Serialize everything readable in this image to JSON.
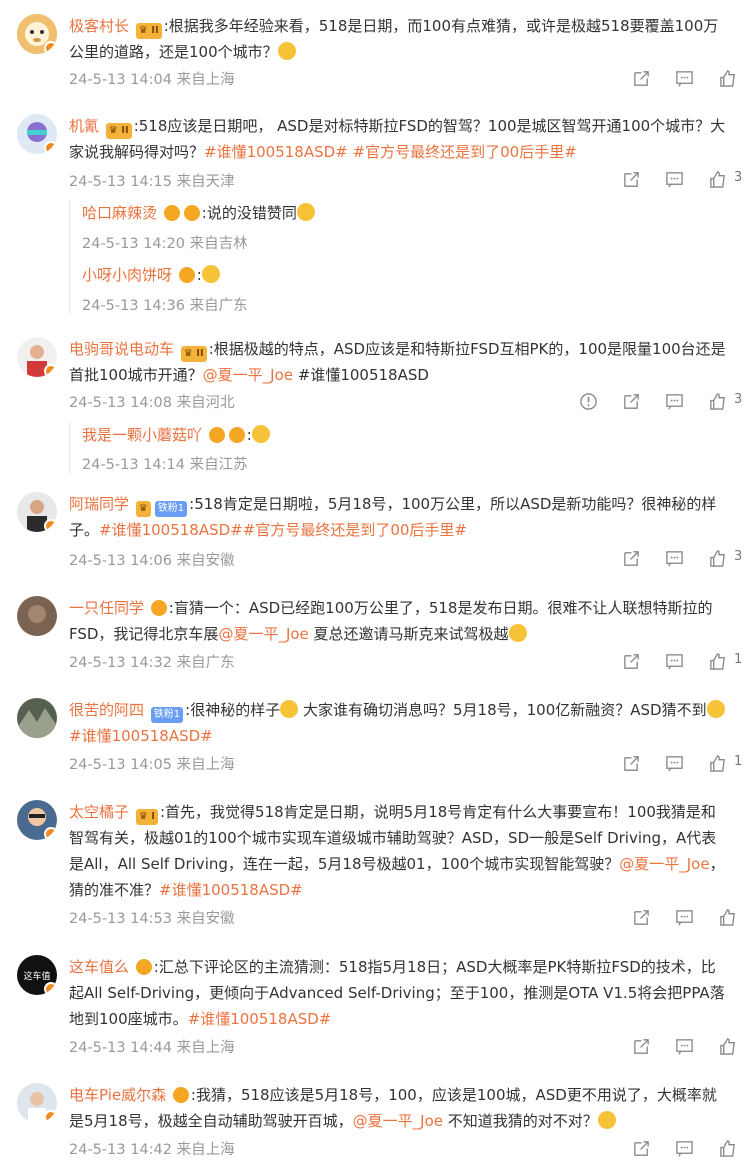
{
  "comments": [
    {
      "user": "极客村长",
      "text": ":根据我多年经验来看，518是日期，而100有点难猜，或许是极越518要覆盖100万公里的道路，还是100个城市？",
      "meta": "24-5-13 14:04 来自上海",
      "likes": ""
    },
    {
      "user": "机氰",
      "text_a": ":518应该是日期吧， ASD是对标特斯拉FSD的智驾？100是城区智驾开通100个城市？大家说我解码得对吗？",
      "topic1": "#谁懂100518ASD#",
      "topic2": "#官方号最终还是到了00后手里#",
      "meta": "24-5-13 14:15 来自天津",
      "likes": "3",
      "replies": [
        {
          "user": "哈口麻辣烫",
          "text": ":说的没错赞同",
          "meta": "24-5-13 14:20 来自吉林"
        },
        {
          "user": "小呀小肉饼呀",
          "text": ":",
          "meta": "24-5-13 14:36 来自广东"
        }
      ]
    },
    {
      "user": "电驹哥说电动车",
      "text_a": ":根据极越的特点，ASD应该是和特斯拉FSD互相PK的，100是限量100台还是首批100城市开通？",
      "mention": "@夏一平_Joe",
      "topic1": "#谁懂100518ASD",
      "meta": "24-5-13 14:08 来自河北",
      "likes": "3",
      "replies": [
        {
          "user": "我是一颗小蘑菇吖",
          "text": ":",
          "meta": "24-5-13 14:14 来自江苏"
        }
      ]
    },
    {
      "user": "阿瑞同学",
      "badge": "铁粉1",
      "text_a": ":518肯定是日期啦，5月18号，100万公里，所以ASD是新功能吗？很神秘的样子。",
      "topic1": "#谁懂100518ASD#",
      "topic2": "#官方号最终还是到了00后手里#",
      "meta": "24-5-13 14:06 来自安徽",
      "likes": "3"
    },
    {
      "user": "一只任同学",
      "text_a": ":盲猜一个：ASD已经跑100万公里了，518是发布日期。很难不让人联想特斯拉的FSD，我记得北京车展",
      "mention": "@夏一平_Joe",
      "text_b": " 夏总还邀请马斯克来试驾极越",
      "meta": "24-5-13 14:32 来自广东",
      "likes": "1"
    },
    {
      "user": "很苦的阿四",
      "badge": "铁粉1",
      "text_a": ":很神秘的样子",
      "text_b": " 大家谁有确切消息吗？5月18号，100亿新融资？ASD猜不到",
      "topic1": "#谁懂100518ASD#",
      "meta": "24-5-13 14:05 来自上海",
      "likes": "1"
    },
    {
      "user": "太空橘子",
      "text_a": ":首先，我觉得518肯定是日期，说明5月18号肯定有什么大事要宣布！100我猜是和智驾有关，极越01的100个城市实现车道级城市辅助驾驶？ASD，SD一般是Self Driving，A代表是All，All Self Driving，连在一起，5月18号极越01，100个城市实现智能驾驶？",
      "mention": "@夏一平_Joe",
      "text_b": "，猜的准不准？",
      "topic1": "#谁懂100518ASD#",
      "meta": "24-5-13 14:53 来自安徽",
      "likes": ""
    },
    {
      "user": "这车值么",
      "text_a": ":汇总下评论区的主流猜测：518指5月18日；ASD大概率是PK特斯拉FSD的技术，比起All Self-Driving，更倾向于Advanced Self-Driving；至于100，推测是OTA V1.5将会把PPA落地到100座城市。",
      "topic1": "#谁懂100518ASD#",
      "meta": "24-5-13 14:44 来自上海",
      "likes": ""
    },
    {
      "user": "电车Pie威尔森",
      "text_a": ":我猜，518应该是5月18号，100，应该是100城，ASD更不用说了，大概率就是5月18号，极越全自动辅助驾驶开百城，",
      "mention": "@夏一平_Joe",
      "text_b": " 不知道我猜的对不对？",
      "meta": "24-5-13 14:42 来自上海",
      "likes": ""
    }
  ],
  "colors": {
    "link": "#eb7340",
    "meta": "#999999",
    "text": "#333333"
  }
}
